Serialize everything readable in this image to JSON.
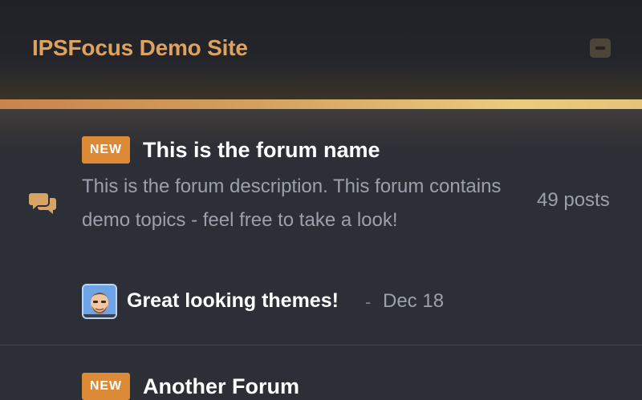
{
  "site": {
    "title": "IPSFocus Demo Site",
    "collapse_icon": "minus-icon"
  },
  "colors": {
    "accent": "#dca25e",
    "badge": "#dd8a37",
    "background": "#2d2f36"
  },
  "forums": [
    {
      "badge": "NEW",
      "name": "This is the forum name",
      "description": "This is the forum description. This forum contains demo topics - feel free to take a look!",
      "posts": "49 posts",
      "icon": "chat-bubbles-icon",
      "last_post": {
        "avatar": "avatar-icon",
        "title": "Great looking themes!",
        "separator": "-",
        "date": "Dec 18"
      }
    },
    {
      "badge": "NEW",
      "name": "Another Forum"
    }
  ]
}
